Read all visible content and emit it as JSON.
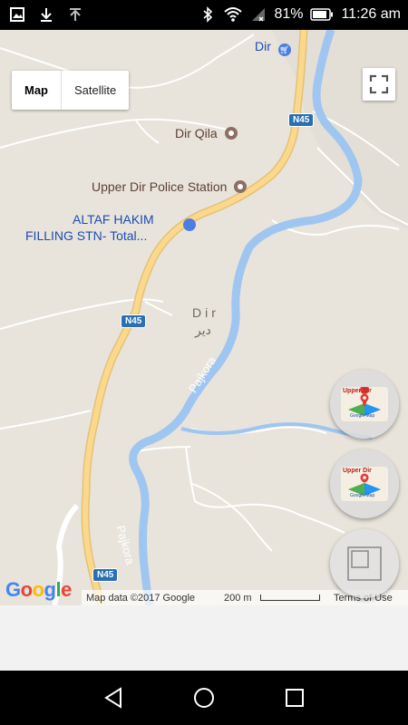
{
  "status_bar": {
    "battery": "81%",
    "time": "11:26 am",
    "icons": [
      "gallery-icon",
      "download-icon",
      "upload-icon",
      "bluetooth-icon",
      "wifi-icon",
      "signal-icon",
      "battery-icon"
    ]
  },
  "map": {
    "type_toggle": {
      "map_label": "Map",
      "satellite_label": "Satellite",
      "selected": "Map"
    },
    "places": {
      "dir_shop": "Dir",
      "dir_qila": "Dir Qila",
      "police": "Upper Dir Police Station",
      "fuel_line1": "ALTAF HAKIM",
      "fuel_line2": "FILLING STN-  Total..."
    },
    "town": {
      "name": "Dir",
      "name_urdu": "دیر"
    },
    "road_shields": [
      "N45",
      "N45",
      "N45"
    ],
    "river_labels": [
      "Pajkora",
      "Pajkora"
    ],
    "attribution": {
      "map_data": "Map data ©2017 Google",
      "scale": "200 m",
      "terms": "Terms of Use"
    },
    "logo": [
      "G",
      "o",
      "o",
      "g",
      "l",
      "e"
    ]
  },
  "fabs": {
    "marker_thumb_text": "Upper Dir",
    "marker_thumb_sub": "Google Map"
  },
  "colors": {
    "water": "#9fc6f0",
    "road_major": "#fbd98b",
    "road_minor": "#ffffff",
    "land": "#e8e4db",
    "shield": "#2a6fb4"
  }
}
